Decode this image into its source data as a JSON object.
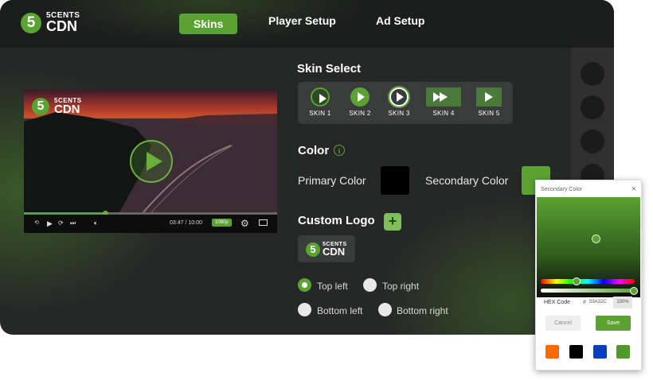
{
  "brand": {
    "mark": "5",
    "line1": "5CENTS",
    "line2": "CDN"
  },
  "nav": {
    "skins": "Skins",
    "player_setup": "Player Setup",
    "ad_setup": "Ad Setup",
    "active": "Skins"
  },
  "player": {
    "time": "03:47 / 10:00",
    "quality": "1080p",
    "progress": 0.32,
    "watermark": {
      "mark": "5",
      "line1": "5CENTS",
      "line2": "CDN"
    }
  },
  "skin_select": {
    "title": "Skin Select",
    "skins": [
      {
        "label": "SKIN 1",
        "style": "outline-circle",
        "selected": false
      },
      {
        "label": "SKIN 2",
        "style": "filled-circle",
        "selected": true
      },
      {
        "label": "SKIN 3",
        "style": "ring-circle",
        "selected": false
      },
      {
        "label": "SKIN 4",
        "style": "rectangle-wide",
        "selected": false
      },
      {
        "label": "SKIN 5",
        "style": "rectangle",
        "selected": false
      }
    ]
  },
  "color": {
    "title": "Color",
    "primary_label": "Primary Color",
    "primary_value": "#000000",
    "secondary_label": "Secondary Color",
    "secondary_value": "#5aa332"
  },
  "custom_logo": {
    "title": "Custom Logo",
    "add_icon": "+",
    "logo": {
      "mark": "5",
      "line1": "5CENTS",
      "line2": "CDN"
    }
  },
  "logo_position": {
    "options": [
      {
        "label": "Top left",
        "selected": true
      },
      {
        "label": "Top right",
        "selected": false
      },
      {
        "label": "Bottom left",
        "selected": false
      },
      {
        "label": "Bottom right",
        "selected": false
      }
    ]
  },
  "color_picker": {
    "title": "Secondary Color",
    "close": "×",
    "hex_label": "HEX Code",
    "hash": "#",
    "hex_value": "59A32C",
    "opacity": "100%",
    "cancel": "Cancel",
    "save": "Save",
    "presets": [
      "#ff6a00",
      "#000000",
      "#0b3fbf",
      "#4f9a2b"
    ]
  },
  "colors": {
    "accent": "#5aa332",
    "background": "#262827",
    "topbar": "#1c1d1d"
  }
}
